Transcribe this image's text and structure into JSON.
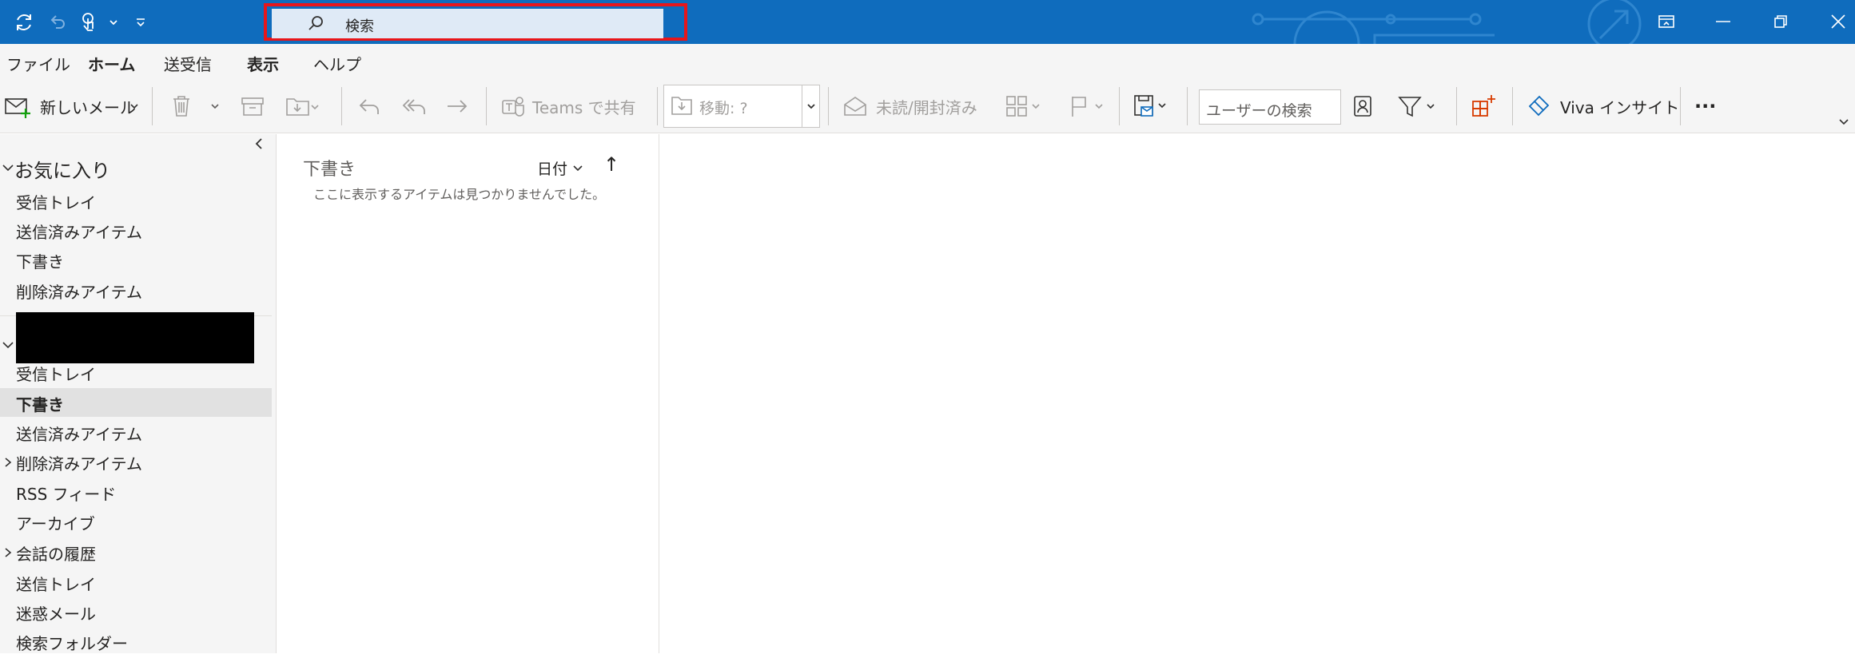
{
  "colors": {
    "titlebar": "#0f6cbd",
    "search_highlight": "#e8161b",
    "accent": "#0f6cbd",
    "disabled_text": "#a19f9d"
  },
  "titlebar": {
    "search_placeholder": "検索",
    "icons": [
      "sync-icon",
      "undo-icon",
      "touch-mode-icon",
      "customize-toolbar-icon"
    ]
  },
  "menu": {
    "tabs": [
      "ファイル",
      "ホーム",
      "送受信",
      "表示",
      "ヘルプ"
    ]
  },
  "ribbon": {
    "new_mail": "新しいメール",
    "teams_share": "Teams で共有",
    "move_label": "移動: ?",
    "read_unread": "未読/開封済み",
    "user_search_placeholder": "ユーザーの検索",
    "viva": "Viva インサイト",
    "more": "···"
  },
  "nav": {
    "favorites_header": "お気に入り",
    "favorites": [
      "受信トレイ",
      "送信済みアイテム",
      "下書き",
      "削除済みアイテム"
    ],
    "account_items": [
      "受信トレイ",
      "下書き",
      "送信済みアイテム",
      "削除済みアイテム",
      "RSS フィード",
      "アーカイブ",
      "会話の履歴",
      "送信トレイ",
      "迷惑メール",
      "検索フォルダー"
    ],
    "selected": "下書き"
  },
  "message_list": {
    "folder_title": "下書き",
    "sort_label": "日付",
    "sort_direction": "↑",
    "empty_text": "ここに表示するアイテムは見つかりませんでした。"
  }
}
